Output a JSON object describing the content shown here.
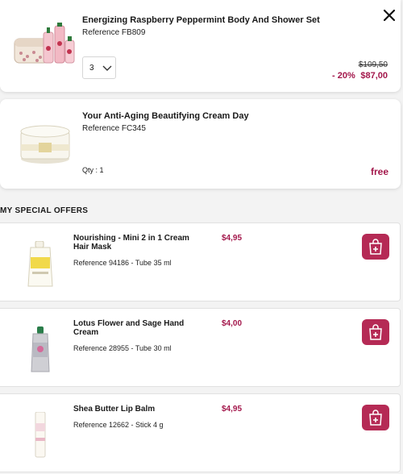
{
  "cart": {
    "items": [
      {
        "title": "Energizing Raspberry Peppermint Body And Shower Set",
        "reference": "Reference FB809",
        "quantity": "3",
        "old_price": "$109,50",
        "discount": "- 20%",
        "price": "$87,00"
      },
      {
        "title": "Your Anti-Aging Beautifying Cream Day",
        "reference": "Reference FC345",
        "quantity_text": "Qty : 1",
        "price": "free"
      }
    ]
  },
  "offers": {
    "title": "MY SPECIAL OFFERS",
    "items": [
      {
        "title": "Nourishing - Mini 2 in 1 Cream Hair Mask",
        "price": "$4,95",
        "reference": "Reference 94186 - Tube 35 ml"
      },
      {
        "title": "Lotus Flower and Sage Hand Cream",
        "price": "$4,00",
        "reference": "Reference 28955 - Tube 30 ml"
      },
      {
        "title": "Shea Butter Lip Balm",
        "price": "$4,95",
        "reference": "Reference 12662 - Stick 4 g"
      }
    ]
  },
  "colors": {
    "accent": "#a3174b",
    "button": "#b52a55"
  }
}
